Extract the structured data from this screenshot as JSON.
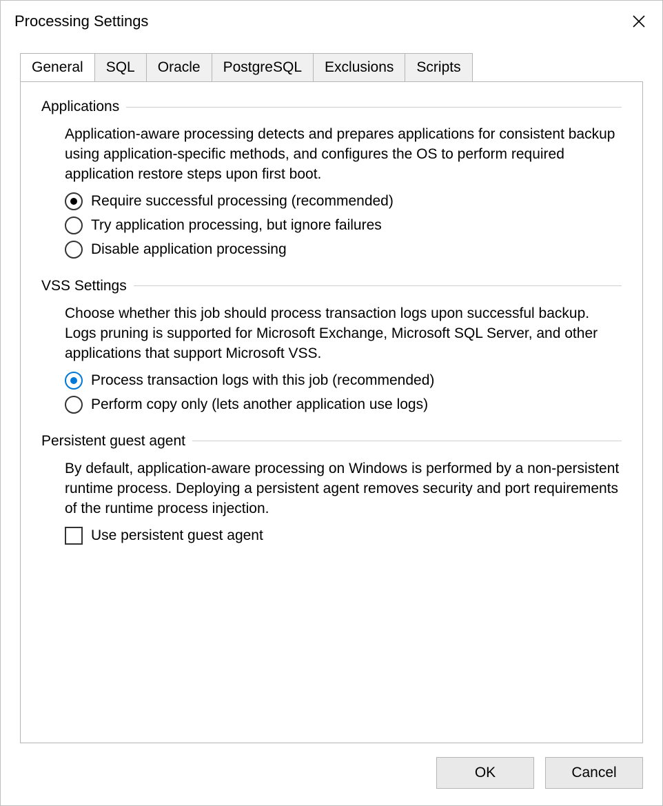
{
  "window": {
    "title": "Processing Settings"
  },
  "tabs": [
    {
      "label": "General"
    },
    {
      "label": "SQL"
    },
    {
      "label": "Oracle"
    },
    {
      "label": "PostgreSQL"
    },
    {
      "label": "Exclusions"
    },
    {
      "label": "Scripts"
    }
  ],
  "groups": {
    "applications": {
      "title": "Applications",
      "desc": "Application-aware processing detects and prepares applications for consistent backup using application-specific methods, and configures the OS to perform required application restore steps upon first boot.",
      "options": [
        "Require successful processing (recommended)",
        "Try application processing, but ignore failures",
        "Disable application processing"
      ]
    },
    "vss": {
      "title": "VSS Settings",
      "desc": "Choose whether this job should process transaction logs upon successful backup. Logs pruning is supported for Microsoft Exchange, Microsoft SQL Server, and other applications that support Microsoft VSS.",
      "options": [
        "Process transaction logs with this job (recommended)",
        "Perform copy only (lets another application use logs)"
      ]
    },
    "persistent": {
      "title": "Persistent guest agent",
      "desc": "By default, application-aware processing on Windows is performed by a non-persistent runtime process. Deploying a persistent agent removes security and port requirements of the runtime process injection.",
      "checkbox": "Use persistent guest agent"
    }
  },
  "buttons": {
    "ok": "OK",
    "cancel": "Cancel"
  }
}
